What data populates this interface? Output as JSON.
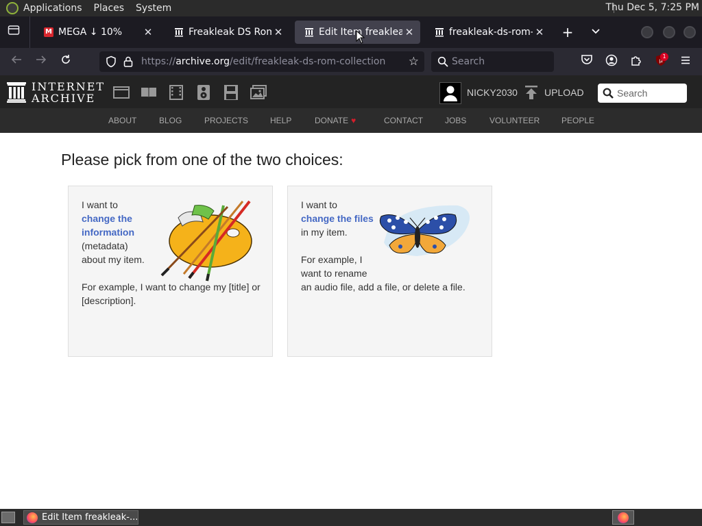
{
  "top_panel": {
    "menus": [
      "Applications",
      "Places",
      "System"
    ],
    "clock": "Thu Dec  5,  7:25 PM"
  },
  "browser": {
    "tabs": [
      {
        "title": "MEGA ↓ 10%",
        "icon": "mega-icon",
        "active": false
      },
      {
        "title": "Freakleak DS Rom Col",
        "icon": "internet-archive-icon",
        "active": false
      },
      {
        "title": "Edit Item freakleak-d",
        "icon": "internet-archive-icon",
        "active": true
      },
      {
        "title": "freakleak-ds-rom-coll",
        "icon": "internet-archive-icon",
        "active": false
      }
    ],
    "url_prefix": "https://",
    "url_host": "archive.org",
    "url_path": "/edit/freakleak-ds-rom-collection",
    "search_placeholder": "Search",
    "extension_badge": "1"
  },
  "ia_header": {
    "wordmark_line1": "INTERNET",
    "wordmark_line2": "ARCHIVE",
    "media_icons": [
      "web-icon",
      "texts-icon",
      "video-icon",
      "audio-icon",
      "software-icon",
      "images-icon"
    ],
    "username": "NICKY2030",
    "upload_label": "UPLOAD",
    "search_placeholder": "Search",
    "nav": [
      "ABOUT",
      "BLOG",
      "PROJECTS",
      "HELP",
      "DONATE",
      "CONTACT",
      "JOBS",
      "VOLUNTEER",
      "PEOPLE"
    ]
  },
  "page": {
    "title": "Please pick from one of the two choices:",
    "card_metadata": {
      "prefix": "I want to",
      "link": "change the information",
      "suffix_1": "(metadata)",
      "suffix_2": "about my item.",
      "example": "For example, I want to change my [title] or [description]."
    },
    "card_files": {
      "prefix": "I want to",
      "link": "change the files",
      "suffix": "in my item.",
      "example_1": "For example, I",
      "example_2": "want to rename",
      "example_3": "an audio file, add a file, or delete a file."
    }
  },
  "taskbar": {
    "window_title": "Edit Item freakleak-..."
  },
  "colors": {
    "ia_dark": "#232323",
    "ia_nav": "#2c2c2c",
    "link_blue": "#4468c4",
    "heart_red": "#d21e2b",
    "firefox_dark": "#1c1b22"
  }
}
